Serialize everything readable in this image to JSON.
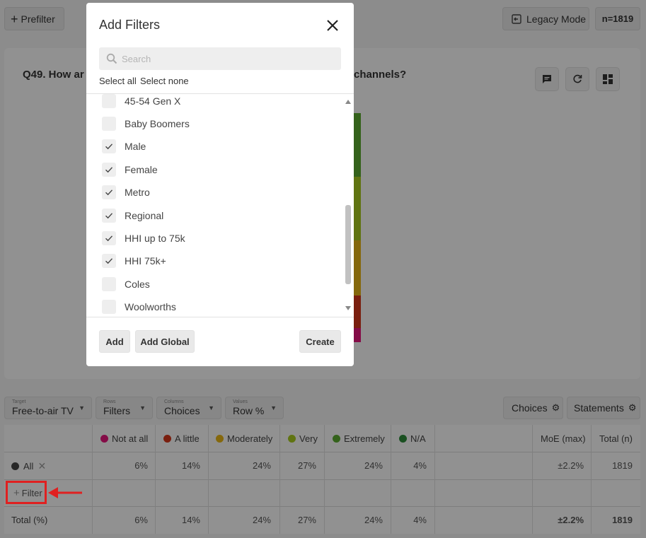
{
  "topbar": {
    "prefilter_label": "Prefilter",
    "legacy_label": "Legacy Mode",
    "n_label": "n=1819"
  },
  "question": {
    "title_left": "Q49. How ar",
    "title_right": "channels?"
  },
  "controls": {
    "target": {
      "small": "Target",
      "value": "Free-to-air TV"
    },
    "rows": {
      "small": "Rows",
      "value": "Filters"
    },
    "columns": {
      "small": "Columns",
      "value": "Choices"
    },
    "values": {
      "small": "Values",
      "value": "Row %"
    },
    "choices_btn": "Choices",
    "statements_btn": "Statements"
  },
  "table": {
    "columns": [
      {
        "label": "Not at all",
        "color": "#e4157a"
      },
      {
        "label": "A little",
        "color": "#d3361b"
      },
      {
        "label": "Moderately",
        "color": "#e6b416"
      },
      {
        "label": "Very",
        "color": "#a6c81e"
      },
      {
        "label": "Extremely",
        "color": "#5aa930"
      },
      {
        "label": "N/A",
        "color": "#2e8b3a"
      }
    ],
    "moe_label": "MoE (max)",
    "total_label": "Total (n)",
    "row_all": {
      "label": "All",
      "values": [
        "6%",
        "14%",
        "24%",
        "27%",
        "24%",
        "4%"
      ],
      "moe": "±2.2%",
      "total": "1819"
    },
    "filter_label": "Filter",
    "row_total": {
      "label": "Total (%)",
      "values": [
        "6%",
        "14%",
        "24%",
        "27%",
        "24%",
        "4%"
      ],
      "moe": "±2.2%",
      "total": "1819"
    }
  },
  "modal": {
    "title": "Add Filters",
    "search_placeholder": "Search",
    "select_all": "Select all",
    "select_none": "Select none",
    "options": [
      {
        "label": "45-54 Gen X",
        "checked": false
      },
      {
        "label": "Baby Boomers",
        "checked": false
      },
      {
        "label": "Male",
        "checked": true
      },
      {
        "label": "Female",
        "checked": true
      },
      {
        "label": "Metro",
        "checked": true
      },
      {
        "label": "Regional",
        "checked": true
      },
      {
        "label": "HHI up to 75k",
        "checked": true
      },
      {
        "label": "HHI 75k+",
        "checked": true
      },
      {
        "label": "Coles",
        "checked": false
      },
      {
        "label": "Woolworths",
        "checked": false
      }
    ],
    "add_label": "Add",
    "add_global_label": "Add Global",
    "create_label": "Create"
  }
}
